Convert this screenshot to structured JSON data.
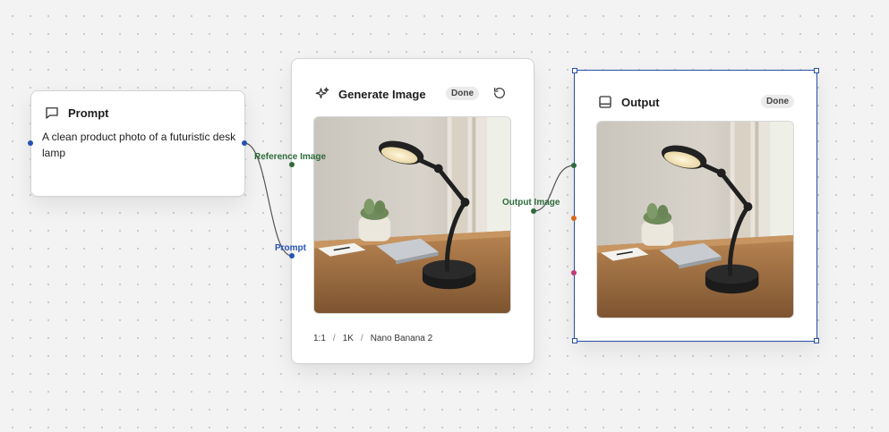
{
  "prompt_node": {
    "title": "Prompt",
    "icon": "message-square-icon",
    "text": "A clean product photo of a futuristic desk lamp"
  },
  "generate_node": {
    "title": "Generate Image",
    "icon": "sparkles-icon",
    "status": "Done",
    "refresh_icon": "refresh-icon",
    "inputs": {
      "reference_image": "Reference Image",
      "prompt": "Prompt"
    },
    "output": "Output Image",
    "settings": {
      "aspect_ratio": "1:1",
      "resolution": "1K",
      "model": "Nano Banana 2",
      "separator": "/"
    }
  },
  "output_node": {
    "title": "Output",
    "icon": "panel-bottom-icon",
    "status": "Done"
  },
  "colors": {
    "image_port": "#2f6b3c",
    "text_port": "#2553b3",
    "orange_port": "#d86a1c",
    "pink_port": "#c13a78",
    "selection": "#2a4fa8"
  }
}
